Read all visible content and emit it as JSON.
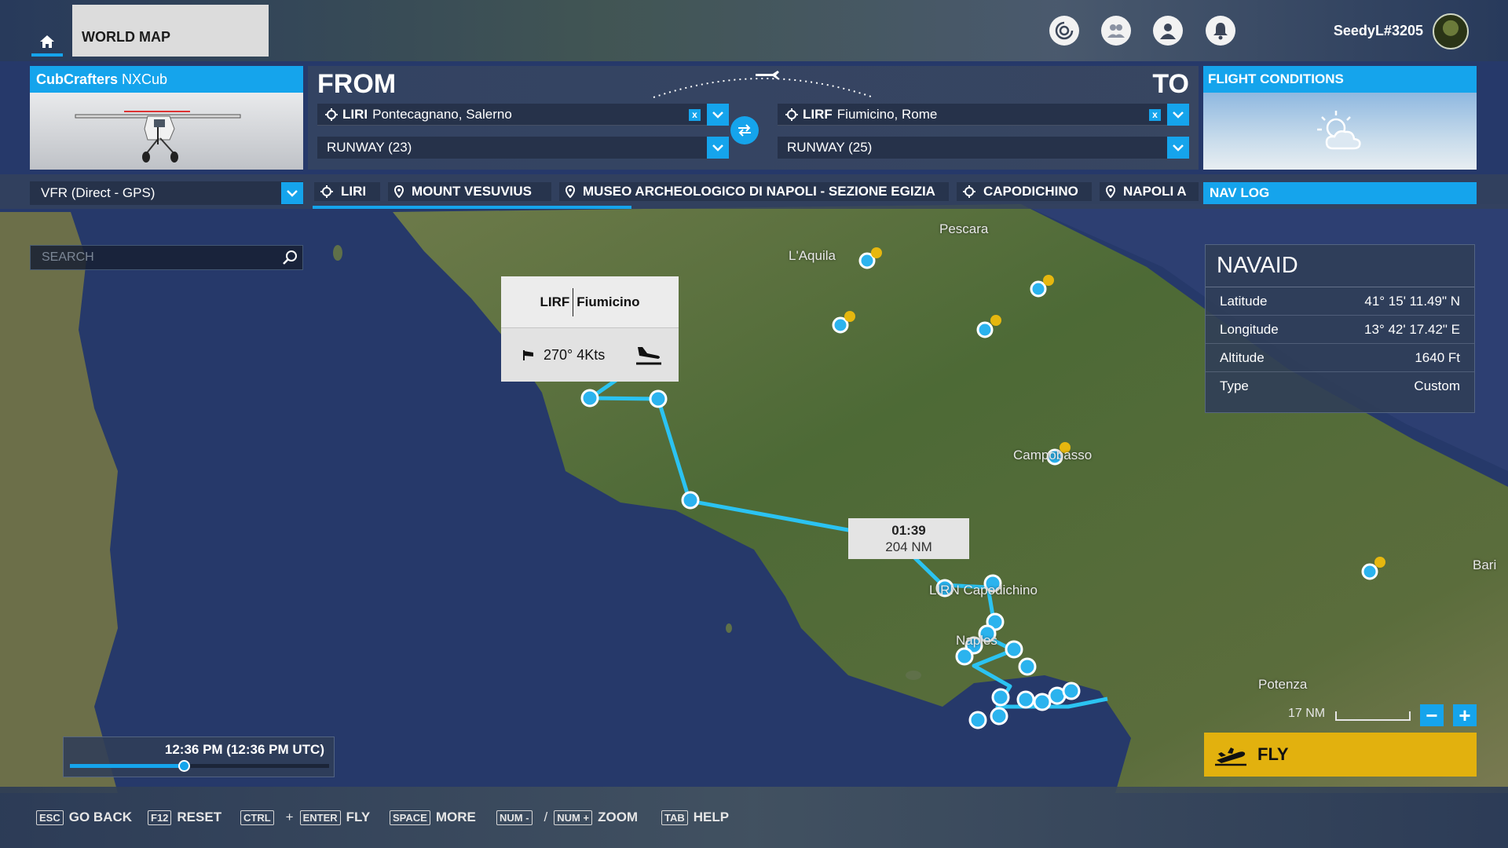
{
  "topbar": {
    "world_map_label": "WORLD MAP",
    "username": "SeedyL#3205",
    "icons": [
      "home-icon",
      "activity-icon",
      "friends-icon",
      "profile-icon",
      "notifications-icon"
    ]
  },
  "aircraft": {
    "brand": "CubCrafters",
    "model": "NXCub"
  },
  "route": {
    "from_label": "FROM",
    "to_label": "TO",
    "from": {
      "icao": "LIRI",
      "name": "Pontecagnano, Salerno",
      "runway": "RUNWAY (23)"
    },
    "to": {
      "icao": "LIRF",
      "name": "Fiumicino, Rome",
      "runway": "RUNWAY (25)"
    },
    "clear_symbol": "x"
  },
  "conditions": {
    "title": "FLIGHT CONDITIONS",
    "icon": "partly-cloudy-icon"
  },
  "flight_plan": {
    "selected": "VFR (Direct - GPS)"
  },
  "waypoints": [
    {
      "label": "LIRI",
      "icon": "airport-icon"
    },
    {
      "label": "MOUNT VESUVIUS",
      "icon": "poi-pin-icon"
    },
    {
      "label": "MUSEO ARCHEOLOGICO DI NAPOLI - SEZIONE EGIZIA",
      "icon": "poi-pin-icon"
    },
    {
      "label": "CAPODICHINO",
      "icon": "airport-icon"
    },
    {
      "label": "NAPOLI A",
      "icon": "poi-pin-icon"
    }
  ],
  "nav_log": {
    "label": "NAV LOG"
  },
  "search": {
    "placeholder": "SEARCH"
  },
  "tooltip": {
    "icao": "LIRF",
    "name": "Fiumicino",
    "wind": "270° 4Kts"
  },
  "leg": {
    "time": "01:39",
    "distance": "204 NM"
  },
  "map_labels": {
    "pescara": "Pescara",
    "laquila": "L'Aquila",
    "campobasso": "Campobasso",
    "capodichino": "LIRN Capodichino",
    "naples": "Naples",
    "potenza": "Potenza",
    "bari": "Bari"
  },
  "navaid": {
    "title": "NAVAID",
    "rows": [
      {
        "label": "Latitude",
        "value": "41° 15' 11.49\" N"
      },
      {
        "label": "Longitude",
        "value": "13° 42' 17.42\" E"
      },
      {
        "label": "Altitude",
        "value": "1640 Ft"
      },
      {
        "label": "Type",
        "value": "Custom"
      }
    ]
  },
  "scale": {
    "label": "17 NM"
  },
  "zoom": {
    "minus": "−",
    "plus": "+"
  },
  "fly": {
    "label": "FLY"
  },
  "time": {
    "label": "12:36 PM (12:36 PM UTC)",
    "slider_fraction": 0.44
  },
  "hints": [
    {
      "keys": [
        "ESC"
      ],
      "label": "GO BACK"
    },
    {
      "keys": [
        "F12"
      ],
      "label": "RESET"
    },
    {
      "keys": [
        "CTRL",
        "ENTER"
      ],
      "glue": "+",
      "label": "FLY"
    },
    {
      "keys": [
        "SPACE"
      ],
      "label": "MORE"
    },
    {
      "keys": [
        "NUM -",
        "NUM +"
      ],
      "glue": "/",
      "label": "ZOOM"
    },
    {
      "keys": [
        "TAB"
      ],
      "label": "HELP"
    }
  ],
  "colors": {
    "accent": "#15a4ec",
    "fly": "#e2b10e",
    "sea": "#273a66",
    "land": "#4f6a37"
  }
}
